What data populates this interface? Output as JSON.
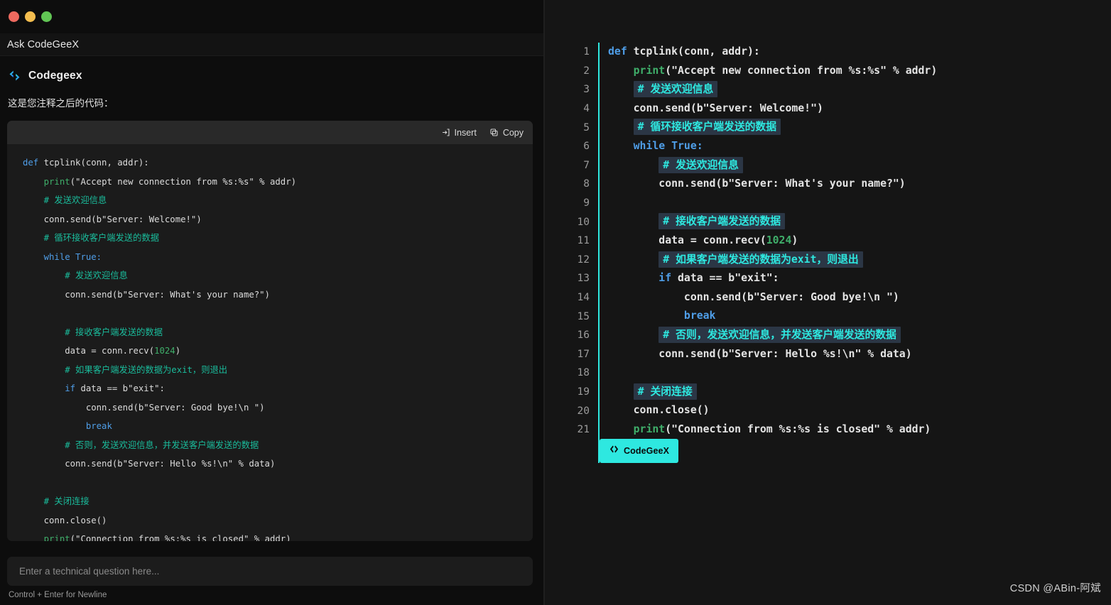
{
  "window": {
    "traffic_lights": [
      {
        "name": "close",
        "color": "#ed6a5f"
      },
      {
        "name": "minimize",
        "color": "#f4bd4f"
      },
      {
        "name": "maximize",
        "color": "#61c554"
      }
    ]
  },
  "header": {
    "title": "Ask CodeGeeX"
  },
  "assistant": {
    "logo_icon": "codegeex-logo-icon",
    "name": "Codegeex",
    "message": "这是您注释之后的代码："
  },
  "code_block": {
    "toolbar": {
      "insert_label": "Insert",
      "insert_icon": "insert-arrow-icon",
      "copy_label": "Copy",
      "copy_icon": "copy-icon"
    },
    "lines": [
      {
        "indent": 0,
        "parts": [
          {
            "t": "def ",
            "c": "kw"
          },
          {
            "t": "tcplink(conn, addr):",
            "c": ""
          }
        ]
      },
      {
        "indent": 1,
        "parts": [
          {
            "t": "print",
            "c": "fn"
          },
          {
            "t": "(\"Accept new connection from %s:%s\" % addr)",
            "c": ""
          }
        ]
      },
      {
        "indent": 1,
        "parts": [
          {
            "t": "# 发送欢迎信息",
            "c": "cm"
          }
        ]
      },
      {
        "indent": 1,
        "parts": [
          {
            "t": "conn.send(b\"Server: Welcome!\")",
            "c": ""
          }
        ]
      },
      {
        "indent": 1,
        "parts": [
          {
            "t": "# 循环接收客户端发送的数据",
            "c": "cm"
          }
        ]
      },
      {
        "indent": 1,
        "parts": [
          {
            "t": "while ",
            "c": "kw"
          },
          {
            "t": "True:",
            "c": "kw"
          }
        ]
      },
      {
        "indent": 2,
        "parts": [
          {
            "t": "# 发送欢迎信息",
            "c": "cm"
          }
        ]
      },
      {
        "indent": 2,
        "parts": [
          {
            "t": "conn.send(b\"Server: What's your name?\")",
            "c": ""
          }
        ]
      },
      {
        "indent": 0,
        "parts": []
      },
      {
        "indent": 2,
        "parts": [
          {
            "t": "# 接收客户端发送的数据",
            "c": "cm"
          }
        ]
      },
      {
        "indent": 2,
        "parts": [
          {
            "t": "data = conn.recv(",
            "c": ""
          },
          {
            "t": "1024",
            "c": "num"
          },
          {
            "t": ")",
            "c": ""
          }
        ]
      },
      {
        "indent": 2,
        "parts": [
          {
            "t": "# 如果客户端发送的数据为exit，则退出",
            "c": "cm"
          }
        ]
      },
      {
        "indent": 2,
        "parts": [
          {
            "t": "if ",
            "c": "kw"
          },
          {
            "t": "data == b\"exit\":",
            "c": ""
          }
        ]
      },
      {
        "indent": 3,
        "parts": [
          {
            "t": "conn.send(b\"Server: Good bye!\\n \")",
            "c": ""
          }
        ]
      },
      {
        "indent": 3,
        "parts": [
          {
            "t": "break",
            "c": "kw"
          }
        ]
      },
      {
        "indent": 2,
        "parts": [
          {
            "t": "# 否则，发送欢迎信息，并发送客户端发送的数据",
            "c": "cm"
          }
        ]
      },
      {
        "indent": 2,
        "parts": [
          {
            "t": "conn.send(b\"Server: Hello %s!\\n\" % data)",
            "c": ""
          }
        ]
      },
      {
        "indent": 0,
        "parts": []
      },
      {
        "indent": 1,
        "parts": [
          {
            "t": "# 关闭连接",
            "c": "cm"
          }
        ]
      },
      {
        "indent": 1,
        "parts": [
          {
            "t": "conn.close()",
            "c": ""
          }
        ]
      },
      {
        "indent": 1,
        "parts": [
          {
            "t": "print",
            "c": "fn"
          },
          {
            "t": "(\"Connection from %s:%s is closed\" % addr)",
            "c": ""
          }
        ]
      }
    ]
  },
  "input": {
    "value": "",
    "placeholder": "Enter a technical question here...",
    "hint": "Control + Enter for Newline"
  },
  "editor": {
    "lines": [
      {
        "n": "1",
        "indent": 0,
        "parts": [
          {
            "t": "def ",
            "c": "ekw"
          },
          {
            "t": "tcplink(conn, addr):",
            "c": ""
          }
        ]
      },
      {
        "n": "2",
        "indent": 1,
        "parts": [
          {
            "t": "print",
            "c": "efn"
          },
          {
            "t": "(\"Accept new connection from %s:%s\" % addr)",
            "c": ""
          }
        ]
      },
      {
        "n": "3",
        "indent": 1,
        "parts": [
          {
            "t": "# 发送欢迎信息",
            "c": "hl"
          }
        ]
      },
      {
        "n": "4",
        "indent": 1,
        "parts": [
          {
            "t": "conn.send(b\"Server: Welcome!\")",
            "c": ""
          }
        ]
      },
      {
        "n": "5",
        "indent": 1,
        "parts": [
          {
            "t": "# 循环接收客户端发送的数据",
            "c": "hl"
          }
        ]
      },
      {
        "n": "6",
        "indent": 1,
        "parts": [
          {
            "t": "while ",
            "c": "ekw"
          },
          {
            "t": "True:",
            "c": "ekw"
          }
        ]
      },
      {
        "n": "7",
        "indent": 2,
        "parts": [
          {
            "t": "# 发送欢迎信息",
            "c": "hl"
          }
        ]
      },
      {
        "n": "8",
        "indent": 2,
        "parts": [
          {
            "t": "conn.send(b\"Server: What's your name?\")",
            "c": ""
          }
        ]
      },
      {
        "n": "9",
        "indent": 0,
        "parts": []
      },
      {
        "n": "10",
        "indent": 2,
        "parts": [
          {
            "t": "# 接收客户端发送的数据",
            "c": "hl"
          }
        ]
      },
      {
        "n": "11",
        "indent": 2,
        "parts": [
          {
            "t": "data = conn.recv(",
            "c": ""
          },
          {
            "t": "1024",
            "c": "enum"
          },
          {
            "t": ")",
            "c": ""
          }
        ]
      },
      {
        "n": "12",
        "indent": 2,
        "parts": [
          {
            "t": "# 如果客户端发送的数据为exit，则退出",
            "c": "hl"
          }
        ]
      },
      {
        "n": "13",
        "indent": 2,
        "parts": [
          {
            "t": "if ",
            "c": "ekw"
          },
          {
            "t": "data == b\"exit\":",
            "c": ""
          }
        ]
      },
      {
        "n": "14",
        "indent": 3,
        "parts": [
          {
            "t": "conn.send(b\"Server: Good bye!\\n \")",
            "c": ""
          }
        ]
      },
      {
        "n": "15",
        "indent": 3,
        "parts": [
          {
            "t": "break",
            "c": "ekw"
          }
        ]
      },
      {
        "n": "16",
        "indent": 2,
        "parts": [
          {
            "t": "# 否则，发送欢迎信息，并发送客户端发送的数据",
            "c": "hl"
          }
        ]
      },
      {
        "n": "17",
        "indent": 2,
        "parts": [
          {
            "t": "conn.send(b\"Server: Hello %s!\\n\" % data)",
            "c": ""
          }
        ]
      },
      {
        "n": "18",
        "indent": 0,
        "parts": []
      },
      {
        "n": "19",
        "indent": 1,
        "parts": [
          {
            "t": "# 关闭连接",
            "c": "hl"
          }
        ]
      },
      {
        "n": "20",
        "indent": 1,
        "parts": [
          {
            "t": "conn.close()",
            "c": ""
          }
        ]
      },
      {
        "n": "21",
        "indent": 1,
        "parts": [
          {
            "t": "print",
            "c": "efn"
          },
          {
            "t": "(\"Connection from %s:%s is closed\" % addr)",
            "c": ""
          }
        ]
      }
    ],
    "badge": {
      "label": "CodeGeeX",
      "icon": "codegeex-code-icon",
      "color": "#2ee8e0"
    }
  },
  "watermark": {
    "text": "CSDN @ABin-阿斌"
  },
  "colors": {
    "accent_cyan": "#2ee8e0",
    "keyword_blue": "#4f9ee8",
    "function_green": "#3fae6a",
    "comment_teal": "#1abc9c",
    "highlight_bg": "#2b3645",
    "panel_bg": "#0d0d0d",
    "editor_bg": "#151515"
  }
}
